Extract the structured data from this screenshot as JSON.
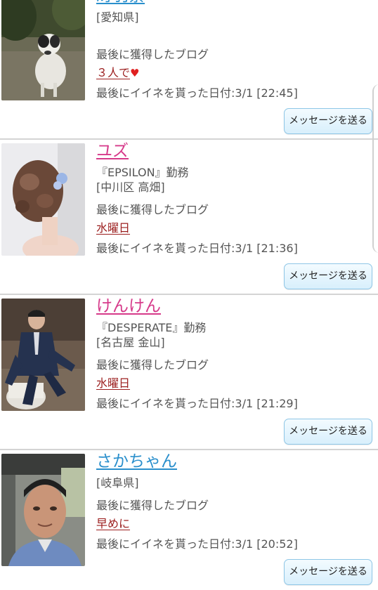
{
  "labels": {
    "last_blog": "最後に獲得したブログ",
    "message_button": "メッセージを送る"
  },
  "entries": [
    {
      "name": "冴羽寮",
      "name_color": "#2a8fcc",
      "workplace": "",
      "location": "[愛知県]",
      "blog_title": "３人で",
      "blog_suffix_icon": "heart-icon",
      "last_like": "最後にイイネを貰った日付:3/1 [22:45]",
      "avatar": "dog-photo"
    },
    {
      "name": "ユズ",
      "name_color": "#d63a8a",
      "workplace": "『EPSILON』勤務",
      "location": "[中川区 高畑]",
      "blog_title": "水曜日",
      "last_like": "最後にイイネを貰った日付:3/1 [21:36]",
      "avatar": "hairstyle-photo"
    },
    {
      "name": "けんけん",
      "name_color": "#d63a8a",
      "workplace": "『DESPERATE』勤務",
      "location": "[名古屋 金山]",
      "blog_title": "水曜日",
      "last_like": "最後にイイネを貰った日付:3/1 [21:29]",
      "avatar": "man-in-suit-photo"
    },
    {
      "name": "さかちゃん",
      "name_color": "#2a8fcc",
      "workplace": "",
      "location": "[岐阜県]",
      "blog_title": "早めに",
      "last_like": "最後にイイネを貰った日付:3/1 [20:52]",
      "avatar": "man-in-car-photo"
    }
  ]
}
